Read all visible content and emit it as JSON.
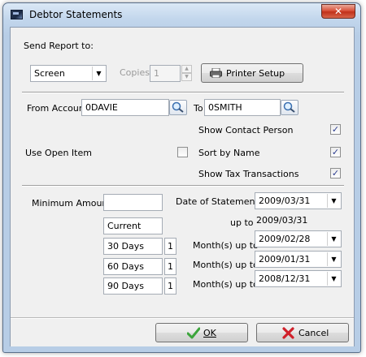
{
  "window": {
    "title": "Debtor Statements",
    "close_glyph": "✕"
  },
  "send_report": {
    "label": "Send Report to:",
    "destination": "Screen",
    "copies_label": "Copies:",
    "copies_value": "1",
    "printer_setup_label": "Printer Setup",
    "printer_setup_mnemonic": "P"
  },
  "accounts": {
    "from_label": "From Account",
    "from_value": "0DAVIE",
    "to_label": "To",
    "to_value": "0SMITH"
  },
  "options": {
    "show_contact_label": "Show Contact Person",
    "show_contact_checked": true,
    "use_open_item_label": "Use Open Item",
    "use_open_item_checked": false,
    "sort_by_name_label": "Sort by Name",
    "sort_by_name_checked": true,
    "show_tax_label": "Show Tax Transactions",
    "show_tax_checked": true
  },
  "amounts": {
    "minimum_amount_label": "Minimum Amount",
    "minimum_amount_value": "",
    "date_of_statements_label": "Date of Statements",
    "date_of_statements_value": "2009/03/31",
    "current_label": "Current",
    "up_to_label": "up to",
    "up_to_value": "2009/03/31",
    "aging": [
      {
        "label": "30 Days",
        "months": "1",
        "months_label": "Month(s) up to",
        "date": "2009/02/28"
      },
      {
        "label": "60 Days",
        "months": "1",
        "months_label": "Month(s) up to",
        "date": "2009/01/31"
      },
      {
        "label": "90 Days",
        "months": "1",
        "months_label": "Month(s) up to",
        "date": "2008/12/31"
      }
    ]
  },
  "footer": {
    "ok_label": "OK",
    "ok_mnemonic": "O",
    "cancel_label": "Cancel",
    "cancel_mnemonic": "C"
  },
  "icons": {
    "dropdown": "chevron-down-icon",
    "lookup": "magnifier-icon",
    "printer": "printer-icon",
    "ok": "checkmark-icon",
    "cancel": "red-x-icon"
  },
  "colors": {
    "check_mark": "#2b3c8f",
    "ok_check": "#3ca53c",
    "cancel_x": "#d0202a",
    "title_bar": "#c2d6ec"
  }
}
